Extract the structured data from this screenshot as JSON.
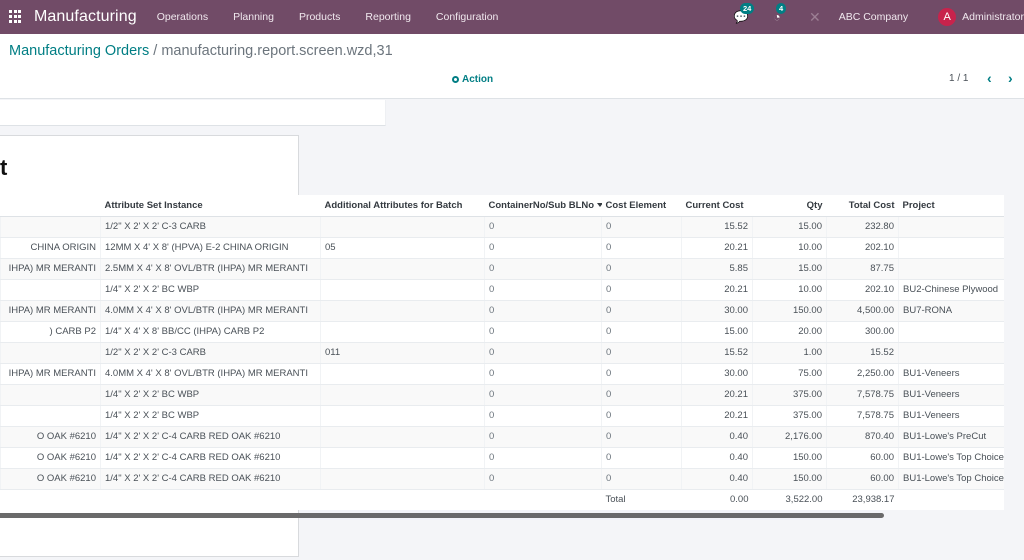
{
  "navbar": {
    "app_name": "Manufacturing",
    "menu": [
      "Operations",
      "Planning",
      "Products",
      "Reporting",
      "Configuration"
    ],
    "messages_count": "24",
    "activities_count": "4",
    "company": "ABC Company",
    "user_initial": "A",
    "user_name": "Administrator",
    "icons": {
      "apps": "apps-grid-icon",
      "messages": "chat-icon",
      "activities": "clock-icon",
      "debug": "close-x-icon"
    }
  },
  "control_panel": {
    "breadcrumb_parent": "Manufacturing Orders",
    "breadcrumb_separator": "/",
    "breadcrumb_current": "manufacturing.report.screen.wzd,31",
    "action_label": "Action",
    "pager_value": "1 / 1",
    "pager_prev": "‹",
    "pager_next": "›"
  },
  "sheet": {
    "title_fragment": "t"
  },
  "table": {
    "columns": [
      "",
      "Attribute Set Instance",
      "Additional Attributes for Batch",
      "ContainerNo/Sub BLNo",
      "Cost Element",
      "Current Cost",
      "Qty",
      "Total Cost",
      "Project"
    ],
    "rows": [
      {
        "c0": "",
        "attr": "1/2\" X 2' X 2' C-3 CARB",
        "batch": "",
        "container": "0",
        "cost_el": "0",
        "cur_cost": "15.52",
        "qty": "15.00",
        "total": "232.80",
        "project": ""
      },
      {
        "c0": " CHINA ORIGIN",
        "attr": "12MM X 4' X 8' (HPVA) E-2 CHINA ORIGIN",
        "batch": "05",
        "container": "0",
        "cost_el": "0",
        "cur_cost": "20.21",
        "qty": "10.00",
        "total": "202.10",
        "project": ""
      },
      {
        "c0": "IHPA) MR MERANTI",
        "attr": "2.5MM X 4' X 8' OVL/BTR (IHPA) MR MERANTI",
        "batch": "",
        "container": "0",
        "cost_el": "0",
        "cur_cost": "5.85",
        "qty": "15.00",
        "total": "87.75",
        "project": ""
      },
      {
        "c0": "",
        "attr": "1/4\" X 2' X 2' BC WBP",
        "batch": "",
        "container": "0",
        "cost_el": "0",
        "cur_cost": "20.21",
        "qty": "10.00",
        "total": "202.10",
        "project": "BU2-Chinese Plywood"
      },
      {
        "c0": "IHPA) MR MERANTI",
        "attr": "4.0MM X 4' X 8' OVL/BTR (IHPA) MR MERANTI",
        "batch": "",
        "container": "0",
        "cost_el": "0",
        "cur_cost": "30.00",
        "qty": "150.00",
        "total": "4,500.00",
        "project": "BU7-RONA"
      },
      {
        "c0": ") CARB P2",
        "attr": "1/4\" X 4' X 8' BB/CC (IHPA) CARB P2",
        "batch": "",
        "container": "0",
        "cost_el": "0",
        "cur_cost": "15.00",
        "qty": "20.00",
        "total": "300.00",
        "project": ""
      },
      {
        "c0": "",
        "attr": "1/2\" X 2' X 2' C-3 CARB",
        "batch": "011",
        "container": "0",
        "cost_el": "0",
        "cur_cost": "15.52",
        "qty": "1.00",
        "total": "15.52",
        "project": ""
      },
      {
        "c0": "IHPA) MR MERANTI",
        "attr": "4.0MM X 4' X 8' OVL/BTR (IHPA) MR MERANTI",
        "batch": "",
        "container": "0",
        "cost_el": "0",
        "cur_cost": "30.00",
        "qty": "75.00",
        "total": "2,250.00",
        "project": "BU1-Veneers"
      },
      {
        "c0": "",
        "attr": "1/4\" X 2' X 2' BC WBP",
        "batch": "",
        "container": "0",
        "cost_el": "0",
        "cur_cost": "20.21",
        "qty": "375.00",
        "total": "7,578.75",
        "project": "BU1-Veneers"
      },
      {
        "c0": "",
        "attr": "1/4\" X 2' X 2' BC WBP",
        "batch": "",
        "container": "0",
        "cost_el": "0",
        "cur_cost": "20.21",
        "qty": "375.00",
        "total": "7,578.75",
        "project": "BU1-Veneers"
      },
      {
        "c0": "O OAK #6210",
        "attr": "1/4\" X 2' X 2' C-4 CARB RED OAK #6210",
        "batch": "",
        "container": "0",
        "cost_el": "0",
        "cur_cost": "0.40",
        "qty": "2,176.00",
        "total": "870.40",
        "project": "BU1-Lowe's PreCut"
      },
      {
        "c0": "O OAK #6210",
        "attr": "1/4\" X 2' X 2' C-4 CARB RED OAK #6210",
        "batch": "",
        "container": "0",
        "cost_el": "0",
        "cur_cost": "0.40",
        "qty": "150.00",
        "total": "60.00",
        "project": "BU1-Lowe's Top Choice"
      },
      {
        "c0": "O OAK #6210",
        "attr": "1/4\" X 2' X 2' C-4 CARB RED OAK #6210",
        "batch": "",
        "container": "0",
        "cost_el": "0",
        "cur_cost": "0.40",
        "qty": "150.00",
        "total": "60.00",
        "project": "BU1-Lowe's Top Choice"
      }
    ],
    "footer": {
      "label": "Total",
      "cur_cost": "0.00",
      "qty": "3,522.00",
      "total": "23,938.17"
    }
  },
  "colors": {
    "navbar": "#714b67",
    "accent": "#017e84",
    "avatar": "#c8234c"
  }
}
